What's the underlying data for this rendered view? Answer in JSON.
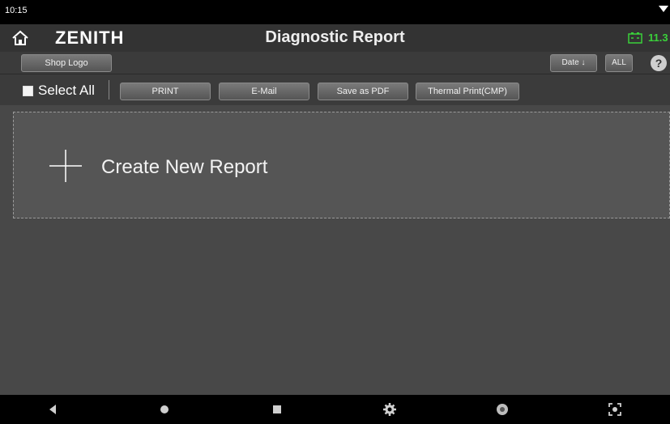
{
  "status": {
    "time": "10:15"
  },
  "header": {
    "logo": "ZENITH",
    "title": "Diagnostic Report",
    "voltage": "11.3"
  },
  "toolbar1": {
    "shop_logo": "Shop Logo",
    "date_sort": "Date ↓",
    "all_filter": "ALL",
    "help": "?"
  },
  "toolbar2": {
    "select_all": "Select All",
    "print": "PRINT",
    "email": "E-Mail",
    "save_pdf": "Save as PDF",
    "thermal_print": "Thermal Print(CMP)"
  },
  "main": {
    "create_report": "Create New Report"
  },
  "navbar": {
    "icons": [
      "back-icon",
      "home-icon",
      "recents-icon",
      "settings-icon",
      "browser-icon",
      "screenshot-icon"
    ]
  },
  "colors": {
    "voltage": "#3ad13a",
    "background": "#4a4a4a"
  }
}
